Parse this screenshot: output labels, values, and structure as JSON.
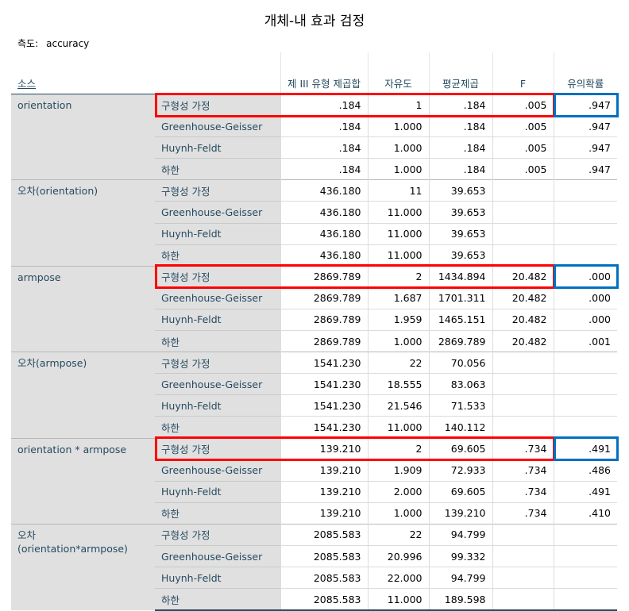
{
  "title": "개체-내 효과 검정",
  "measure": {
    "label": "측도:",
    "value": "accuracy"
  },
  "headers": {
    "source": "소스",
    "ss": "제 III 유형 제곱합",
    "df": "자유도",
    "ms": "평균제곱",
    "f": "F",
    "sig": "유의확률"
  },
  "highlight_colors": {
    "row": "#ff0000",
    "sig": "#0070c0"
  },
  "groups": [
    {
      "source": "orientation",
      "highlighted": true,
      "rows": [
        {
          "label": "구형성 가정",
          "ss": ".184",
          "df": "1",
          "ms": ".184",
          "f": ".005",
          "sig": ".947"
        },
        {
          "label": "Greenhouse-Geisser",
          "ss": ".184",
          "df": "1.000",
          "ms": ".184",
          "f": ".005",
          "sig": ".947"
        },
        {
          "label": "Huynh-Feldt",
          "ss": ".184",
          "df": "1.000",
          "ms": ".184",
          "f": ".005",
          "sig": ".947"
        },
        {
          "label": "하한",
          "ss": ".184",
          "df": "1.000",
          "ms": ".184",
          "f": ".005",
          "sig": ".947"
        }
      ]
    },
    {
      "source": "오차(orientation)",
      "highlighted": false,
      "rows": [
        {
          "label": "구형성 가정",
          "ss": "436.180",
          "df": "11",
          "ms": "39.653",
          "f": "",
          "sig": ""
        },
        {
          "label": "Greenhouse-Geisser",
          "ss": "436.180",
          "df": "11.000",
          "ms": "39.653",
          "f": "",
          "sig": ""
        },
        {
          "label": "Huynh-Feldt",
          "ss": "436.180",
          "df": "11.000",
          "ms": "39.653",
          "f": "",
          "sig": ""
        },
        {
          "label": "하한",
          "ss": "436.180",
          "df": "11.000",
          "ms": "39.653",
          "f": "",
          "sig": ""
        }
      ]
    },
    {
      "source": "armpose",
      "highlighted": true,
      "rows": [
        {
          "label": "구형성 가정",
          "ss": "2869.789",
          "df": "2",
          "ms": "1434.894",
          "f": "20.482",
          "sig": ".000"
        },
        {
          "label": "Greenhouse-Geisser",
          "ss": "2869.789",
          "df": "1.687",
          "ms": "1701.311",
          "f": "20.482",
          "sig": ".000"
        },
        {
          "label": "Huynh-Feldt",
          "ss": "2869.789",
          "df": "1.959",
          "ms": "1465.151",
          "f": "20.482",
          "sig": ".000"
        },
        {
          "label": "하한",
          "ss": "2869.789",
          "df": "1.000",
          "ms": "2869.789",
          "f": "20.482",
          "sig": ".001"
        }
      ]
    },
    {
      "source": "오차(armpose)",
      "highlighted": false,
      "rows": [
        {
          "label": "구형성 가정",
          "ss": "1541.230",
          "df": "22",
          "ms": "70.056",
          "f": "",
          "sig": ""
        },
        {
          "label": "Greenhouse-Geisser",
          "ss": "1541.230",
          "df": "18.555",
          "ms": "83.063",
          "f": "",
          "sig": ""
        },
        {
          "label": "Huynh-Feldt",
          "ss": "1541.230",
          "df": "21.546",
          "ms": "71.533",
          "f": "",
          "sig": ""
        },
        {
          "label": "하한",
          "ss": "1541.230",
          "df": "11.000",
          "ms": "140.112",
          "f": "",
          "sig": ""
        }
      ]
    },
    {
      "source": "orientation * armpose",
      "highlighted": true,
      "rows": [
        {
          "label": "구형성 가정",
          "ss": "139.210",
          "df": "2",
          "ms": "69.605",
          "f": ".734",
          "sig": ".491"
        },
        {
          "label": "Greenhouse-Geisser",
          "ss": "139.210",
          "df": "1.909",
          "ms": "72.933",
          "f": ".734",
          "sig": ".486"
        },
        {
          "label": "Huynh-Feldt",
          "ss": "139.210",
          "df": "2.000",
          "ms": "69.605",
          "f": ".734",
          "sig": ".491"
        },
        {
          "label": "하한",
          "ss": "139.210",
          "df": "1.000",
          "ms": "139.210",
          "f": ".734",
          "sig": ".410"
        }
      ]
    },
    {
      "source": "오차 (orientation*armpose)",
      "highlighted": false,
      "rows": [
        {
          "label": "구형성 가정",
          "ss": "2085.583",
          "df": "22",
          "ms": "94.799",
          "f": "",
          "sig": ""
        },
        {
          "label": "Greenhouse-Geisser",
          "ss": "2085.583",
          "df": "20.996",
          "ms": "99.332",
          "f": "",
          "sig": ""
        },
        {
          "label": "Huynh-Feldt",
          "ss": "2085.583",
          "df": "22.000",
          "ms": "94.799",
          "f": "",
          "sig": ""
        },
        {
          "label": "하한",
          "ss": "2085.583",
          "df": "11.000",
          "ms": "189.598",
          "f": "",
          "sig": ""
        }
      ]
    }
  ]
}
